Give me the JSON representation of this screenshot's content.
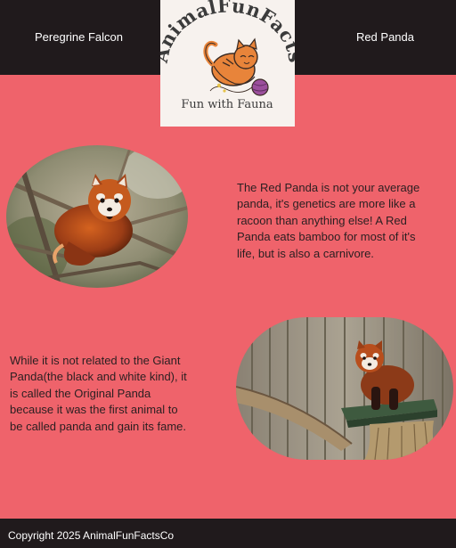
{
  "header": {
    "nav_left": "Peregrine Falcon",
    "nav_right": "Red Panda",
    "logo": {
      "title": "AnimalFunFacts",
      "tagline": "Fun with Fauna"
    }
  },
  "sections": [
    {
      "image_name": "red-panda-in-tree-photo",
      "text": "The Red Panda is not your average panda, it's genetics are more like a racoon than anything else! A Red Panda eats bamboo for most of it's life, but is also a carnivore."
    },
    {
      "image_name": "red-panda-on-platform-photo",
      "text": "While it is not related to the Giant Panda(the black and white kind), it is called the Original Panda because it was the first animal to be called panda and gain its fame."
    }
  ],
  "footer": {
    "copyright": "Copyright 2025 AnimalFunFactsCo"
  },
  "colors": {
    "page_background": "#ef636b",
    "header_background": "#201a1c",
    "logo_background": "#f7f2ee",
    "body_text": "#2a1f21",
    "nav_text": "#ffffff"
  }
}
